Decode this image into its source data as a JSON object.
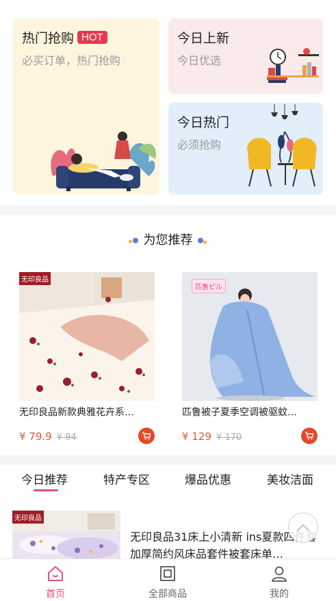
{
  "promos": {
    "hot": {
      "title": "热门抢购",
      "badge": "HOT",
      "subtitle": "必买订单，热门抢购"
    },
    "new": {
      "title": "今日上新",
      "subtitle": "今日优选"
    },
    "trend": {
      "title": "今日热门",
      "subtitle": "必须抢购"
    }
  },
  "recommend": {
    "heading": "为您推荐",
    "products": [
      {
        "brand": "无印良品",
        "name": "无印良品新款典雅花卉系…",
        "price": "¥ 79.9",
        "old_price": "¥ 94"
      },
      {
        "brand": "匹鲁ピル",
        "name": "匹鲁被子夏季空调被驱蚊…",
        "price": "¥ 129",
        "old_price": "¥ 170"
      }
    ]
  },
  "tabs": [
    "今日推荐",
    "特产专区",
    "爆品优惠",
    "美妆洁面"
  ],
  "list": {
    "items": [
      {
        "brand": "无印良品",
        "title": "无印良品31床上小清新 ins夏款四件套加厚简约风床品套件被套床单…"
      }
    ]
  },
  "navbar": {
    "items": [
      "首页",
      "全部商品",
      "我的"
    ],
    "active": "首页"
  },
  "colors": {
    "accent": "#e2507a",
    "price": "#e8552f",
    "hot_badge": "#e8384f"
  }
}
